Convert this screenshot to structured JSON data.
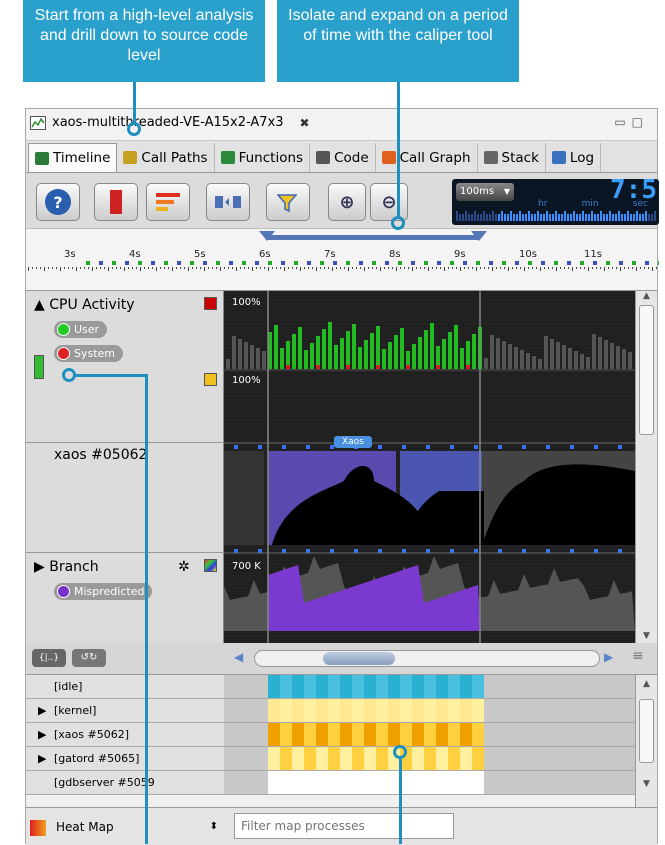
{
  "callouts": {
    "left": "Start from a high-level analysis and drill down to source code level",
    "right": "Isolate and expand on a period of time with the caliper tool"
  },
  "window": {
    "title": "xaos-multithreaded-VE-A15x2-A7x3",
    "tabs": [
      {
        "label": "Timeline",
        "icon": "timeline-icon"
      },
      {
        "label": "Call Paths",
        "icon": "call-paths-icon"
      },
      {
        "label": "Functions",
        "icon": "functions-icon"
      },
      {
        "label": "Code",
        "icon": "code-icon"
      },
      {
        "label": "Call Graph",
        "icon": "call-graph-icon"
      },
      {
        "label": "Stack",
        "icon": "stack-icon"
      },
      {
        "label": "Log",
        "icon": "log-icon"
      }
    ]
  },
  "toolbar": {
    "zoom_select": "100ms",
    "clock": "7:5",
    "clock_units": [
      "hr",
      "min",
      "sec"
    ]
  },
  "ruler": {
    "ticks": [
      "3s",
      "4s",
      "5s",
      "6s",
      "7s",
      "8s",
      "9s",
      "10s",
      "11s"
    ]
  },
  "timeline": {
    "cpu": {
      "title": "CPU Activity",
      "user": "User",
      "system": "System",
      "top_label": "100%",
      "bottom_label": "100%"
    },
    "process": {
      "title": "xaos #05062",
      "tooltip": "Xaos"
    },
    "branch": {
      "title": "Branch",
      "mispredicted": "Mispredicted",
      "scale": "700 K"
    }
  },
  "heatmap": {
    "rows": [
      "[idle]",
      "[kernel]",
      "[xaos #5062]",
      "[gatord #5065]",
      "[gdbserver #5059"
    ],
    "expandable": [
      false,
      true,
      true,
      true,
      false
    ]
  },
  "bottom": {
    "mode": "Heat Map",
    "filter_placeholder": "Filter map processes"
  },
  "colors": {
    "callout": "#2aa0cc",
    "user": "#22cc22",
    "system": "#dd2222",
    "mispredicted": "#7733cc"
  }
}
